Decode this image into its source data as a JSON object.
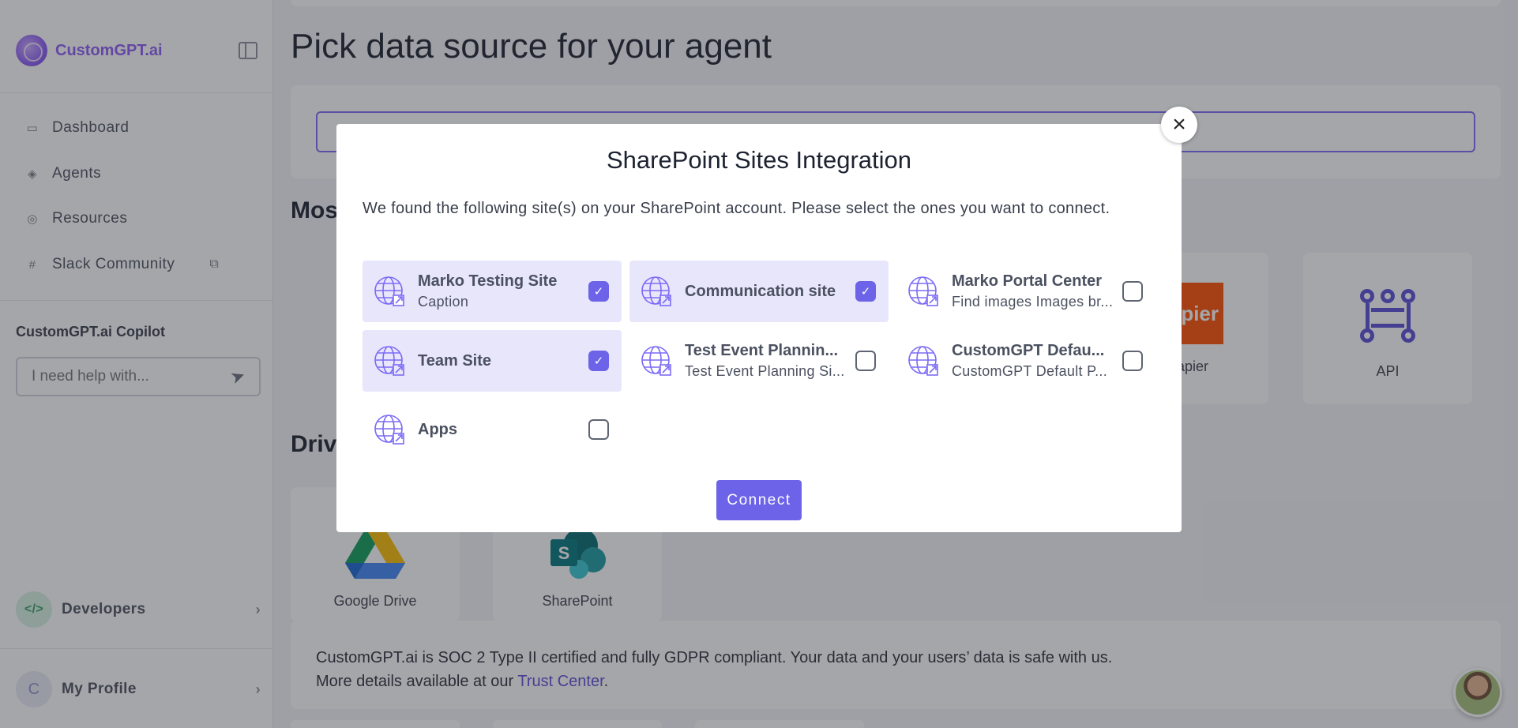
{
  "sidebar": {
    "brand": "CustomGPT.ai",
    "nav": [
      {
        "label": "Dashboard",
        "icon": "monitor-icon"
      },
      {
        "label": "Agents",
        "icon": "layers-icon"
      },
      {
        "label": "Resources",
        "icon": "lifebuoy-icon"
      },
      {
        "label": "Slack Community",
        "icon": "slack-icon"
      }
    ],
    "copilot": {
      "label": "CustomGPT.ai Copilot",
      "placeholder": "I need help with..."
    },
    "developers": {
      "label": "Developers",
      "icon_text": "</>"
    },
    "profile": {
      "label": "My Profile",
      "initial": "C"
    }
  },
  "main": {
    "title": "Pick data source for your agent",
    "section_most": "Mos",
    "section_drive": "Drive",
    "cards": {
      "zapier_fragment": "pier",
      "zapier_label": "apier",
      "api_label": "API",
      "gdrive_label": "Google Drive",
      "sharepoint_label": "SharePoint"
    },
    "footer": {
      "line1": "CustomGPT.ai is SOC 2 Type II certified and fully GDPR compliant. Your data and your users’ data is safe with us.",
      "line2_prefix": "More details available at our ",
      "link": "Trust Center",
      "line2_suffix": "."
    }
  },
  "modal": {
    "title": "SharePoint Sites Integration",
    "description": "We found the following site(s) on your SharePoint account. Please select the ones you want to connect.",
    "close": "×",
    "sites": [
      {
        "name": "Marko Testing Site",
        "caption": "Caption",
        "checked": true
      },
      {
        "name": "Communication site",
        "caption": "",
        "checked": true
      },
      {
        "name": "Marko Portal Center",
        "caption": "Find images Images br...",
        "checked": false
      },
      {
        "name": "Team Site",
        "caption": "",
        "checked": true
      },
      {
        "name": "Test Event Plannin...",
        "caption": "Test Event Planning Si...",
        "checked": false
      },
      {
        "name": "CustomGPT Defau...",
        "caption": "CustomGPT Default P...",
        "checked": false
      },
      {
        "name": "Apps",
        "caption": "",
        "checked": false
      }
    ],
    "connect": "Connect"
  },
  "colors": {
    "accent": "#6c63e8",
    "brand": "#8d5cf6",
    "selected_bg": "#e8e6fb"
  }
}
